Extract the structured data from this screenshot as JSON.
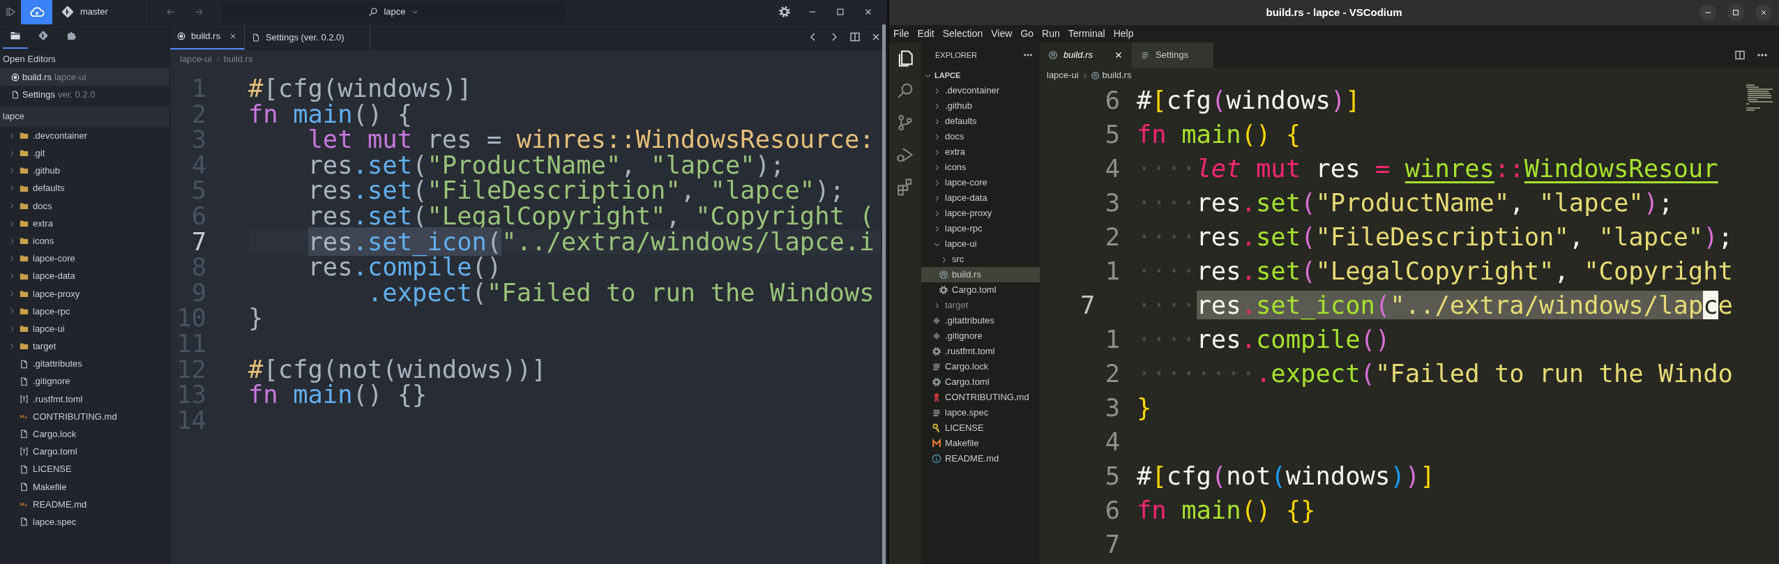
{
  "left_window": {
    "top_bar": {
      "branch": "master",
      "workspace": "lapce"
    },
    "sidebar_tabs": [
      {
        "kind": "explorer",
        "selected": true
      },
      {
        "kind": "source_control",
        "selected": false
      },
      {
        "kind": "plugins",
        "selected": false
      }
    ],
    "open_editors": {
      "title": "Open Editors",
      "items": [
        {
          "name": "build.rs",
          "detail": "lapce-ui",
          "kind": "rust",
          "selected": true
        },
        {
          "name": "Settings",
          "detail": "ver. 0.2.0",
          "kind": "settings",
          "selected": false
        }
      ]
    },
    "explorer": {
      "title": "lapce",
      "items": [
        {
          "name": ".devcontainer",
          "kind": "folder"
        },
        {
          "name": ".git",
          "kind": "folder"
        },
        {
          "name": ".github",
          "kind": "folder"
        },
        {
          "name": "defaults",
          "kind": "folder"
        },
        {
          "name": "docs",
          "kind": "folder"
        },
        {
          "name": "extra",
          "kind": "folder"
        },
        {
          "name": "icons",
          "kind": "folder"
        },
        {
          "name": "lapce-core",
          "kind": "folder"
        },
        {
          "name": "lapce-data",
          "kind": "folder"
        },
        {
          "name": "lapce-proxy",
          "kind": "folder"
        },
        {
          "name": "lapce-rpc",
          "kind": "folder"
        },
        {
          "name": "lapce-ui",
          "kind": "folder"
        },
        {
          "name": "target",
          "kind": "folder"
        },
        {
          "name": ".gitattributes",
          "kind": "file"
        },
        {
          "name": ".gitignore",
          "kind": "file"
        },
        {
          "name": ".rustfmt.toml",
          "kind": "toml"
        },
        {
          "name": "CONTRIBUTING.md",
          "kind": "markdown"
        },
        {
          "name": "Cargo.lock",
          "kind": "file"
        },
        {
          "name": "Cargo.toml",
          "kind": "toml"
        },
        {
          "name": "LICENSE",
          "kind": "file"
        },
        {
          "name": "Makefile",
          "kind": "file"
        },
        {
          "name": "README.md",
          "kind": "markdown"
        },
        {
          "name": "lapce.spec",
          "kind": "file"
        }
      ]
    },
    "tabs": [
      {
        "label": "build.rs",
        "kind": "rust",
        "selected": true
      },
      {
        "label": "Settings (ver. 0.2.0)",
        "kind": "settings",
        "selected": false
      }
    ],
    "breadcrumb": [
      "lapce-ui",
      "build.rs"
    ],
    "code": [
      {
        "number": "1",
        "current": false,
        "tokens": [
          {
            "text": "#",
            "kind": "attr"
          },
          {
            "text": "[cfg(windows)]",
            "kind": "plain"
          }
        ]
      },
      {
        "number": "2",
        "current": false,
        "tokens": [
          {
            "text": "fn ",
            "kind": "keyword"
          },
          {
            "text": "main",
            "kind": "function"
          },
          {
            "text": "() {",
            "kind": "plain"
          }
        ]
      },
      {
        "number": "3",
        "current": false,
        "tokens": [
          {
            "text": "    let mut",
            "kind": "keyword"
          },
          {
            "text": " res = ",
            "kind": "plain"
          },
          {
            "text": "winres::WindowsResource:",
            "kind": "type"
          }
        ]
      },
      {
        "number": "4",
        "current": false,
        "tokens": [
          {
            "text": "    res",
            "kind": "plain"
          },
          {
            "text": ".set",
            "kind": "method"
          },
          {
            "text": "(",
            "kind": "plain"
          },
          {
            "text": "\"ProductName\"",
            "kind": "string"
          },
          {
            "text": ", ",
            "kind": "plain"
          },
          {
            "text": "\"lapce\"",
            "kind": "string"
          },
          {
            "text": ");",
            "kind": "plain"
          }
        ]
      },
      {
        "number": "5",
        "current": false,
        "tokens": [
          {
            "text": "    res",
            "kind": "plain"
          },
          {
            "text": ".set",
            "kind": "method"
          },
          {
            "text": "(",
            "kind": "plain"
          },
          {
            "text": "\"FileDescription\"",
            "kind": "string"
          },
          {
            "text": ", ",
            "kind": "plain"
          },
          {
            "text": "\"lapce\"",
            "kind": "string"
          },
          {
            "text": ");",
            "kind": "plain"
          }
        ]
      },
      {
        "number": "6",
        "current": false,
        "tokens": [
          {
            "text": "    res",
            "kind": "plain"
          },
          {
            "text": ".set",
            "kind": "method"
          },
          {
            "text": "(",
            "kind": "plain"
          },
          {
            "text": "\"LegalCopyright\"",
            "kind": "string"
          },
          {
            "text": ", ",
            "kind": "plain"
          },
          {
            "text": "\"Copyright (",
            "kind": "string"
          }
        ]
      },
      {
        "number": "7",
        "current": true,
        "tokens": [
          {
            "text": "    res",
            "kind": "plain",
            "selected": true
          },
          {
            "text": ".set_icon",
            "kind": "method",
            "selected": true
          },
          {
            "text": "(",
            "kind": "plain",
            "selected": true
          },
          {
            "text": "\"../extra/windows/lapce.i",
            "kind": "string",
            "selected": false
          }
        ]
      },
      {
        "number": "8",
        "current": false,
        "tokens": [
          {
            "text": "    res",
            "kind": "plain"
          },
          {
            "text": ".compile",
            "kind": "method"
          },
          {
            "text": "()",
            "kind": "plain"
          }
        ]
      },
      {
        "number": "9",
        "current": false,
        "tokens": [
          {
            "text": "        .expect",
            "kind": "method"
          },
          {
            "text": "(",
            "kind": "plain"
          },
          {
            "text": "\"Failed to run the Windows",
            "kind": "string"
          }
        ]
      },
      {
        "number": "10",
        "current": false,
        "tokens": [
          {
            "text": "}",
            "kind": "plain"
          }
        ]
      },
      {
        "number": "11",
        "current": false
      },
      {
        "number": "12",
        "current": false,
        "tokens": [
          {
            "text": "#",
            "kind": "attr"
          },
          {
            "text": "[cfg(not(windows))]",
            "kind": "plain"
          }
        ]
      },
      {
        "number": "13",
        "current": false,
        "tokens": [
          {
            "text": "fn ",
            "kind": "keyword"
          },
          {
            "text": "main",
            "kind": "function"
          },
          {
            "text": "() {}",
            "kind": "plain"
          }
        ]
      },
      {
        "number": "14",
        "current": false
      }
    ]
  },
  "right_window": {
    "title": "build.rs - lapce - VSCodium",
    "menu": [
      "File",
      "Edit",
      "Selection",
      "View",
      "Go",
      "Run",
      "Terminal",
      "Help"
    ],
    "activity": [
      {
        "kind": "explorer",
        "selected": true
      },
      {
        "kind": "search",
        "selected": false
      },
      {
        "kind": "source_control",
        "selected": false
      },
      {
        "kind": "run",
        "selected": false
      },
      {
        "kind": "extensions",
        "selected": false
      }
    ],
    "explorer": {
      "title": "EXPLORER",
      "root": {
        "name": "LAPCE",
        "expanded": true
      },
      "items": [
        {
          "name": ".devcontainer",
          "kind": "folder",
          "expanded": false,
          "selected": false,
          "muted": false
        },
        {
          "name": ".github",
          "kind": "folder",
          "expanded": false,
          "selected": false,
          "muted": false
        },
        {
          "name": "defaults",
          "kind": "folder",
          "expanded": false,
          "selected": false,
          "muted": false
        },
        {
          "name": "docs",
          "kind": "folder",
          "expanded": false,
          "selected": false,
          "muted": false
        },
        {
          "name": "extra",
          "kind": "folder",
          "expanded": false,
          "selected": false,
          "muted": false
        },
        {
          "name": "icons",
          "kind": "folder",
          "expanded": false,
          "selected": false,
          "muted": false
        },
        {
          "name": "lapce-core",
          "kind": "folder",
          "expanded": false,
          "selected": false,
          "muted": false
        },
        {
          "name": "lapce-data",
          "kind": "folder",
          "expanded": false,
          "selected": false,
          "muted": false
        },
        {
          "name": "lapce-proxy",
          "kind": "folder",
          "expanded": false,
          "selected": false,
          "muted": false
        },
        {
          "name": "lapce-rpc",
          "kind": "folder",
          "expanded": false,
          "selected": false,
          "muted": false
        },
        {
          "name": "lapce-ui",
          "kind": "folder",
          "expanded": true,
          "selected": false,
          "muted": false,
          "children": [
            {
              "name": "src",
              "kind": "folder",
              "expanded": false,
              "selected": false,
              "muted": false
            },
            {
              "name": "build.rs",
              "kind": "rust",
              "selected": true,
              "muted": false
            },
            {
              "name": "Cargo.toml",
              "kind": "config",
              "selected": false,
              "muted": false
            }
          ]
        },
        {
          "name": "target",
          "kind": "folder",
          "expanded": false,
          "selected": false,
          "muted": true
        },
        {
          "name": ".gitattributes",
          "kind": "git",
          "selected": false,
          "muted": false
        },
        {
          "name": ".gitignore",
          "kind": "git",
          "selected": false,
          "muted": false
        },
        {
          "name": ".rustfmt.toml",
          "kind": "config",
          "selected": false,
          "muted": false
        },
        {
          "name": "Cargo.lock",
          "kind": "text",
          "selected": false,
          "muted": false
        },
        {
          "name": "Cargo.toml",
          "kind": "config",
          "selected": false,
          "muted": false
        },
        {
          "name": "CONTRIBUTING.md",
          "kind": "ribbon",
          "selected": false,
          "muted": false
        },
        {
          "name": "lapce.spec",
          "kind": "text",
          "selected": false,
          "muted": false
        },
        {
          "name": "LICENSE",
          "kind": "license",
          "selected": false,
          "muted": false
        },
        {
          "name": "Makefile",
          "kind": "makefile",
          "selected": false,
          "muted": false
        },
        {
          "name": "README.md",
          "kind": "readme",
          "selected": false,
          "muted": false
        }
      ]
    },
    "tabs": [
      {
        "label": "build.rs",
        "kind": "rust",
        "selected": true
      },
      {
        "label": "Settings",
        "kind": "settings",
        "selected": false
      }
    ],
    "breadcrumb": [
      {
        "text": "lapce-ui",
        "kind": "folder"
      },
      {
        "text": "build.rs",
        "kind": "rust"
      }
    ],
    "code": [
      {
        "number": "6",
        "current": false,
        "tokens": [
          {
            "text": "#",
            "kind": "plain"
          },
          {
            "text": "[",
            "kind": "bracket1"
          },
          {
            "text": "cfg",
            "kind": "plain"
          },
          {
            "text": "(",
            "kind": "bracket2"
          },
          {
            "text": "windows",
            "kind": "plain"
          },
          {
            "text": ")",
            "kind": "bracket2"
          },
          {
            "text": "]",
            "kind": "bracket1"
          }
        ]
      },
      {
        "number": "5",
        "current": false,
        "tokens": [
          {
            "text": "fn ",
            "kind": "keyword"
          },
          {
            "text": "main",
            "kind": "function"
          },
          {
            "text": "() ",
            "kind": "bracket1"
          },
          {
            "text": "{",
            "kind": "bracket1"
          }
        ]
      },
      {
        "number": "4",
        "current": false,
        "tokens": [
          {
            "text": "····",
            "kind": "whitespace"
          },
          {
            "text": "let ",
            "kind": "keyword_italic"
          },
          {
            "text": "mut",
            "kind": "keyword"
          },
          {
            "text": " res ",
            "kind": "plain"
          },
          {
            "text": "= ",
            "kind": "operator"
          },
          {
            "text": "winres",
            "kind": "type"
          },
          {
            "text": "::",
            "kind": "operator"
          },
          {
            "text": "WindowsResour",
            "kind": "type"
          }
        ]
      },
      {
        "number": "3",
        "current": false,
        "tokens": [
          {
            "text": "····",
            "kind": "whitespace"
          },
          {
            "text": "res",
            "kind": "plain"
          },
          {
            "text": ".",
            "kind": "operator"
          },
          {
            "text": "set",
            "kind": "function"
          },
          {
            "text": "(",
            "kind": "bracket2"
          },
          {
            "text": "\"ProductName\"",
            "kind": "string"
          },
          {
            "text": ", ",
            "kind": "plain"
          },
          {
            "text": "\"lapce\"",
            "kind": "string"
          },
          {
            "text": ")",
            "kind": "bracket2"
          },
          {
            "text": ";",
            "kind": "plain"
          }
        ]
      },
      {
        "number": "2",
        "current": false,
        "tokens": [
          {
            "text": "····",
            "kind": "whitespace"
          },
          {
            "text": "res",
            "kind": "plain"
          },
          {
            "text": ".",
            "kind": "operator"
          },
          {
            "text": "set",
            "kind": "function"
          },
          {
            "text": "(",
            "kind": "bracket2"
          },
          {
            "text": "\"FileDescription\"",
            "kind": "string"
          },
          {
            "text": ", ",
            "kind": "plain"
          },
          {
            "text": "\"lapce\"",
            "kind": "string"
          },
          {
            "text": ")",
            "kind": "bracket2"
          },
          {
            "text": ";",
            "kind": "plain"
          }
        ]
      },
      {
        "number": "1",
        "current": false,
        "tokens": [
          {
            "text": "····",
            "kind": "whitespace"
          },
          {
            "text": "res",
            "kind": "plain"
          },
          {
            "text": ".",
            "kind": "operator"
          },
          {
            "text": "set",
            "kind": "function"
          },
          {
            "text": "(",
            "kind": "bracket2"
          },
          {
            "text": "\"LegalCopyright\"",
            "kind": "string"
          },
          {
            "text": ", ",
            "kind": "plain"
          },
          {
            "text": "\"Copyright",
            "kind": "string"
          }
        ]
      },
      {
        "number": "7",
        "current": true,
        "tokens": [
          {
            "text": "····",
            "kind": "whitespace",
            "selected": false,
            "cursor": false
          },
          {
            "text": "res",
            "kind": "plain",
            "selected": true,
            "cursor": false
          },
          {
            "text": ".",
            "kind": "operator",
            "selected": true,
            "cursor": false
          },
          {
            "text": "set_icon",
            "kind": "function",
            "selected": true,
            "cursor": false
          },
          {
            "text": "(",
            "kind": "bracket2",
            "selected": true,
            "cursor": false
          },
          {
            "text": "\"../extra/windows/lap",
            "kind": "string",
            "selected": true,
            "cursor": false
          },
          {
            "text": "c",
            "kind": "string",
            "cursor": true
          },
          {
            "text": "e",
            "kind": "string",
            "selected": false,
            "cursor": false
          }
        ]
      },
      {
        "number": "1",
        "current": false,
        "tokens": [
          {
            "text": "····",
            "kind": "whitespace"
          },
          {
            "text": "res",
            "kind": "plain"
          },
          {
            "text": ".",
            "kind": "operator"
          },
          {
            "text": "compile",
            "kind": "function"
          },
          {
            "text": "()",
            "kind": "bracket2"
          }
        ]
      },
      {
        "number": "2",
        "current": false,
        "tokens": [
          {
            "text": "········",
            "kind": "whitespace"
          },
          {
            "text": ".",
            "kind": "operator"
          },
          {
            "text": "expect",
            "kind": "function"
          },
          {
            "text": "(",
            "kind": "bracket2"
          },
          {
            "text": "\"Failed to run the Windo",
            "kind": "string"
          }
        ]
      },
      {
        "number": "3",
        "current": false,
        "tokens": [
          {
            "text": "}",
            "kind": "bracket1"
          }
        ]
      },
      {
        "number": "4",
        "current": false
      },
      {
        "number": "5",
        "current": false,
        "tokens": [
          {
            "text": "#",
            "kind": "plain"
          },
          {
            "text": "[",
            "kind": "bracket1"
          },
          {
            "text": "cfg",
            "kind": "plain"
          },
          {
            "text": "(",
            "kind": "bracket2"
          },
          {
            "text": "not",
            "kind": "plain"
          },
          {
            "text": "(",
            "kind": "bracket3"
          },
          {
            "text": "windows",
            "kind": "plain"
          },
          {
            "text": ")",
            "kind": "bracket3"
          },
          {
            "text": ")",
            "kind": "bracket2"
          },
          {
            "text": "]",
            "kind": "bracket1"
          }
        ]
      },
      {
        "number": "6",
        "current": false,
        "tokens": [
          {
            "text": "fn ",
            "kind": "keyword"
          },
          {
            "text": "main",
            "kind": "function"
          },
          {
            "text": "() ",
            "kind": "bracket1"
          },
          {
            "text": "{}",
            "kind": "bracket1"
          }
        ]
      },
      {
        "number": "7",
        "current": false
      }
    ]
  }
}
